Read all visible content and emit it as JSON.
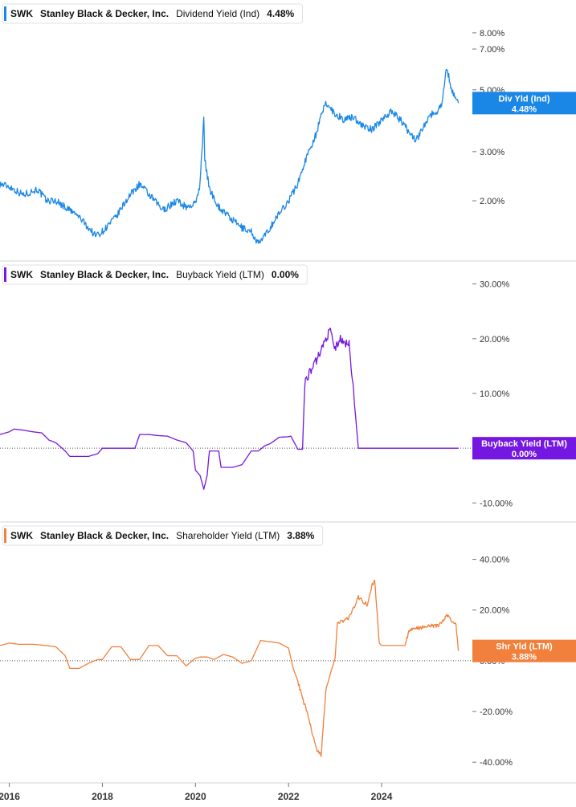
{
  "chart_data": [
    {
      "type": "line",
      "legend": {
        "ticker": "SWK",
        "company": "Stanley Black & Decker, Inc.",
        "metric": "Dividend Yield (Ind)",
        "value": "4.48%"
      },
      "color": "#1a87e6",
      "scale": "log",
      "ylim": [
        1.3,
        9.5
      ],
      "y_ticks": [
        2,
        3,
        5,
        7,
        8
      ],
      "y_tick_labels": [
        "2.00%",
        "3.00%",
        "5.00%",
        "7.00%",
        "8.00%"
      ],
      "badge": {
        "line1": "Div Yld (Ind)",
        "line2": "4.48%",
        "value": 4.48
      },
      "zero_line": false,
      "series": [
        {
          "x": [
            2015.8,
            2016.0,
            2016.3,
            2016.6,
            2016.8,
            2017.0,
            2017.2,
            2017.5,
            2017.7,
            2017.85,
            2018.0,
            2018.3,
            2018.55,
            2018.8,
            2019.0,
            2019.3,
            2019.6,
            2019.8,
            2020.0,
            2020.1,
            2020.18,
            2020.2,
            2020.3,
            2020.5,
            2020.8,
            2021.0,
            2021.2,
            2021.35,
            2021.5,
            2021.7,
            2021.9,
            2022.0,
            2022.2,
            2022.4,
            2022.6,
            2022.8,
            2023.0,
            2023.2,
            2023.4,
            2023.6,
            2023.8,
            2024.0,
            2024.2,
            2024.4,
            2024.6,
            2024.75,
            2024.9,
            2025.0,
            2025.2,
            2025.3,
            2025.4,
            2025.5,
            2025.6,
            2025.65
          ],
          "y": [
            2.3,
            2.25,
            2.1,
            2.2,
            2.0,
            2.0,
            1.9,
            1.75,
            1.6,
            1.5,
            1.55,
            1.75,
            2.05,
            2.3,
            2.1,
            1.85,
            2.0,
            1.9,
            1.95,
            2.3,
            3.9,
            2.8,
            2.2,
            1.9,
            1.7,
            1.6,
            1.55,
            1.4,
            1.5,
            1.7,
            1.9,
            2.0,
            2.3,
            2.9,
            3.5,
            4.5,
            4.1,
            3.9,
            4.0,
            3.7,
            3.6,
            3.9,
            4.2,
            3.9,
            3.5,
            3.3,
            3.7,
            4.0,
            4.2,
            4.5,
            6.0,
            5.0,
            4.7,
            4.48
          ]
        }
      ]
    },
    {
      "type": "line",
      "legend": {
        "ticker": "SWK",
        "company": "Stanley Black & Decker, Inc.",
        "metric": "Buyback Yield (LTM)",
        "value": "0.00%"
      },
      "color": "#7417e0",
      "scale": "linear",
      "ylim": [
        -12,
        32
      ],
      "y_ticks": [
        -10,
        0,
        10,
        20,
        30
      ],
      "y_tick_labels": [
        "-10.00%",
        "0.00%",
        "10.00%",
        "20.00%",
        "30.00%"
      ],
      "badge": {
        "line1": "Buyback Yield (LTM)",
        "line2": "0.00%",
        "value": 0
      },
      "zero_line": true,
      "series": [
        {
          "x": [
            2015.8,
            2016.0,
            2016.1,
            2016.3,
            2016.5,
            2016.7,
            2016.85,
            2017.0,
            2017.2,
            2017.3,
            2017.5,
            2017.7,
            2017.9,
            2018.0,
            2018.2,
            2018.4,
            2018.7,
            2018.8,
            2019.0,
            2019.2,
            2019.4,
            2019.6,
            2019.8,
            2019.95,
            2020.0,
            2020.1,
            2020.18,
            2020.25,
            2020.3,
            2020.5,
            2020.55,
            2020.8,
            2021.0,
            2021.2,
            2021.35,
            2021.5,
            2021.6,
            2021.8,
            2022.0,
            2022.05,
            2022.2,
            2022.3,
            2022.35,
            2022.4,
            2022.6,
            2022.8,
            2022.9,
            2023.0,
            2023.1,
            2023.2,
            2023.3,
            2023.5,
            2024.0,
            2024.5,
            2025.0,
            2025.5,
            2025.65
          ],
          "y": [
            2.5,
            3.0,
            3.5,
            3.3,
            3.0,
            2.8,
            1.5,
            1.0,
            -0.5,
            -1.5,
            -1.5,
            -1.5,
            -1.0,
            0,
            0,
            0,
            0,
            2.5,
            2.5,
            2.3,
            2.2,
            1.5,
            1.0,
            -0.5,
            -4.0,
            -5.0,
            -7.5,
            -5.0,
            -0.5,
            -0.5,
            -3.5,
            -3.5,
            -3.0,
            -0.5,
            -0.5,
            0.5,
            0.8,
            2.0,
            2.1,
            2.2,
            -0.2,
            -0.2,
            12.0,
            13.0,
            16.0,
            20.0,
            21.5,
            18.0,
            20.0,
            19.0,
            19.5,
            0,
            0,
            0,
            0,
            0,
            0
          ]
        }
      ]
    },
    {
      "type": "line",
      "legend": {
        "ticker": "SWK",
        "company": "Stanley Black & Decker, Inc.",
        "metric": "Shareholder Yield (LTM)",
        "value": "3.88%"
      },
      "color": "#f0803c",
      "scale": "linear",
      "ylim": [
        -45,
        50
      ],
      "y_ticks": [
        -40,
        -20,
        0,
        20,
        40
      ],
      "y_tick_labels": [
        "-40.00%",
        "-20.00%",
        "0.00%",
        "20.00%",
        "40.00%"
      ],
      "badge": {
        "line1": "Shr Yld (LTM)",
        "line2": "3.88%",
        "value": 3.88
      },
      "zero_line": true,
      "series": [
        {
          "x": [
            2015.8,
            2016.0,
            2016.2,
            2016.5,
            2016.8,
            2017.0,
            2017.2,
            2017.3,
            2017.5,
            2017.7,
            2017.9,
            2018.0,
            2018.2,
            2018.4,
            2018.6,
            2018.8,
            2019.0,
            2019.2,
            2019.4,
            2019.6,
            2019.8,
            2020.0,
            2020.1,
            2020.25,
            2020.4,
            2020.6,
            2020.8,
            2021.0,
            2021.2,
            2021.4,
            2021.6,
            2021.8,
            2022.0,
            2022.1,
            2022.2,
            2022.3,
            2022.4,
            2022.5,
            2022.6,
            2022.7,
            2022.8,
            2022.9,
            2023.0,
            2023.05,
            2023.1,
            2023.3,
            2023.5,
            2023.7,
            2023.8,
            2023.85,
            2023.95,
            2024.0,
            2024.3,
            2024.5,
            2024.6,
            2024.8,
            2025.0,
            2025.2,
            2025.3,
            2025.4,
            2025.5,
            2025.6,
            2025.65
          ],
          "y": [
            6,
            7,
            6.5,
            6.5,
            6.0,
            5.5,
            2.0,
            -3.0,
            -3.0,
            -1.0,
            0.5,
            0.5,
            5.5,
            5.5,
            0.5,
            0.5,
            6.0,
            6.0,
            2.0,
            2.0,
            -2.0,
            1.0,
            1.5,
            1.5,
            0.5,
            2.5,
            1.5,
            -1.0,
            0,
            8.0,
            7.5,
            7.0,
            5.0,
            -3.0,
            -8.0,
            -15.0,
            -20.0,
            -28.0,
            -35.0,
            -37.0,
            -12.0,
            -5.0,
            1.0,
            15.0,
            15.0,
            17.0,
            25.0,
            22.0,
            30.0,
            32.0,
            7.0,
            6.0,
            6.0,
            6.0,
            12.0,
            13.0,
            13.5,
            14.0,
            15.0,
            18.0,
            16.0,
            14.0,
            3.88
          ]
        }
      ]
    }
  ],
  "x_axis": {
    "xlim": [
      2015.8,
      2025.95
    ],
    "ticks": [
      2016,
      2018,
      2020,
      2022,
      2024
    ],
    "tick_labels": [
      "2016",
      "2018",
      "2020",
      "2022",
      "2024"
    ]
  }
}
